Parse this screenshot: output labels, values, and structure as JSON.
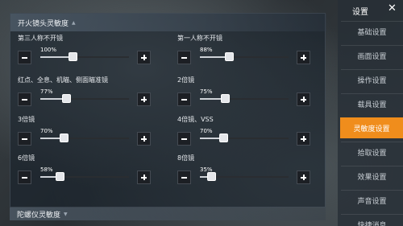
{
  "section": {
    "title": "开火镜头灵敏度",
    "collapse_icon": "caret-up-icon"
  },
  "settings": [
    {
      "label": "第三人称不开镜",
      "value": "100%",
      "level": 0.36
    },
    {
      "label": "第一人称不开镜",
      "value": "88%",
      "level": 0.33
    },
    {
      "label": "红点、全息、机瞄、侧面瞄准镜",
      "value": "77%",
      "level": 0.29
    },
    {
      "label": "2倍镜",
      "value": "75%",
      "level": 0.28
    },
    {
      "label": "3倍镜",
      "value": "70%",
      "level": 0.26
    },
    {
      "label": "4倍镜、VSS",
      "value": "70%",
      "level": 0.26
    },
    {
      "label": "6倍镜",
      "value": "58%",
      "level": 0.22
    },
    {
      "label": "8倍镜",
      "value": "35%",
      "level": 0.13
    }
  ],
  "gyro_section": {
    "title": "陀螺仪灵敏度"
  },
  "sidebar": {
    "title": "设置",
    "close_label": "✕",
    "items": [
      {
        "label": "基础设置"
      },
      {
        "label": "画面设置"
      },
      {
        "label": "操作设置"
      },
      {
        "label": "载具设置"
      },
      {
        "label": "灵敏度设置",
        "active": true
      },
      {
        "label": "拾取设置"
      },
      {
        "label": "效果设置"
      },
      {
        "label": "声音设置"
      },
      {
        "label": "快捷消息"
      }
    ]
  },
  "colors": {
    "accent": "#f08d1c",
    "panel_bg": "#19222c",
    "button_bg": "#1c1f24"
  }
}
